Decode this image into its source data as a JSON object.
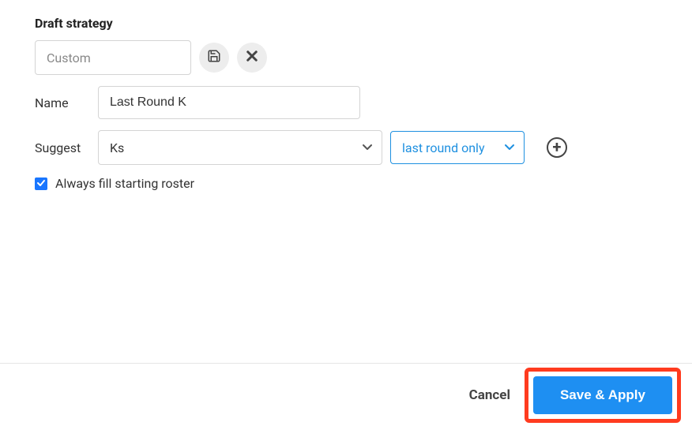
{
  "title": "Draft strategy",
  "strategy": {
    "selected": "Custom"
  },
  "name": {
    "label": "Name",
    "value": "Last Round K"
  },
  "suggest": {
    "label": "Suggest",
    "position": "Ks",
    "timing": "last round only"
  },
  "checkbox": {
    "label": "Always fill starting roster",
    "checked": true
  },
  "footer": {
    "cancel": "Cancel",
    "save": "Save & Apply"
  }
}
